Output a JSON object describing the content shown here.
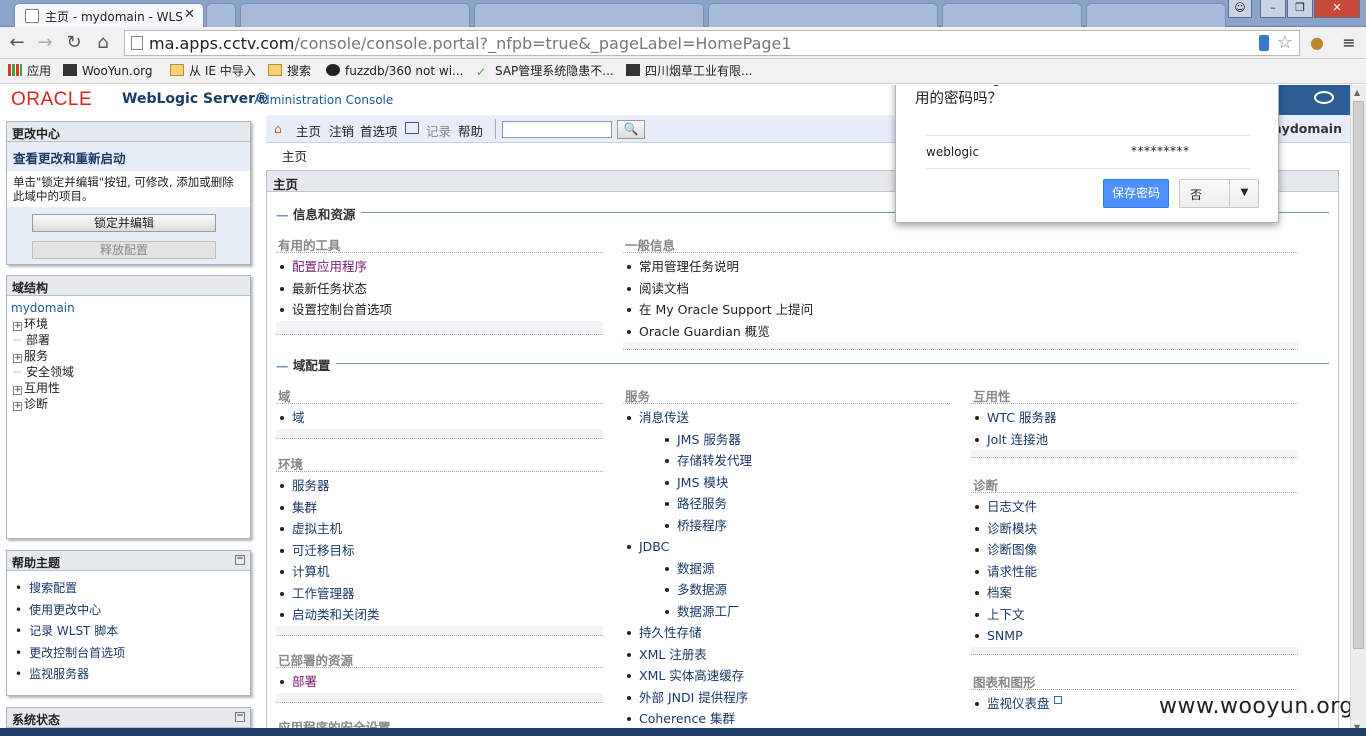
{
  "browser": {
    "active_tab_title": "主页 - mydomain - WLS",
    "inactive_tabs": [
      "",
      "",
      "",
      "",
      "",
      ""
    ],
    "url_host": "ma.apps.cctv.com",
    "url_path": "/console/console.portal?_nfpb=true&_pageLabel=HomePage1",
    "bookmarks": [
      "应用",
      "WooYun.org",
      "从 IE 中导入",
      "搜索",
      "fuzzdb/360 not wi...",
      "SAP管理系统隐患不...",
      "四川烟草工业有限..."
    ]
  },
  "header": {
    "logo": "ORACLE",
    "product": "WebLogic Server®",
    "subtitle": "Administration Console"
  },
  "change_center": {
    "title": "更改中心",
    "subtitle": "查看更改和重新启动",
    "description": "单击\"锁定并编辑\"按钮, 可修改, 添加或删除此域中的项目。",
    "lock_button": "锁定并编辑",
    "release_button": "释放配置"
  },
  "domain_structure": {
    "title": "域结构",
    "root": "mydomain",
    "nodes": [
      {
        "label": "环境",
        "expandable": true
      },
      {
        "label": "部署",
        "expandable": false
      },
      {
        "label": "服务",
        "expandable": true
      },
      {
        "label": "安全领域",
        "expandable": false
      },
      {
        "label": "互用性",
        "expandable": true
      },
      {
        "label": "诊断",
        "expandable": true
      }
    ]
  },
  "help_topics": {
    "title": "帮助主题",
    "items": [
      "搜索配置",
      "使用更改中心",
      "记录 WLST 脚本",
      "更改控制台首选项",
      "监视服务器"
    ]
  },
  "system_status": {
    "title": "系统状态"
  },
  "topnav": {
    "home": "主页",
    "logout": "注销",
    "preferences": "首选项",
    "record": "记录",
    "help": "帮助",
    "search_placeholder": "",
    "welcome_user": "mydomain"
  },
  "breadcrumb": "主页",
  "content_title": "主页",
  "sections": {
    "info": "信息和资源",
    "domain_config": "域配置"
  },
  "groups": {
    "useful_tools": {
      "title": "有用的工具",
      "items": [
        "配置应用程序",
        "最新任务状态",
        "设置控制台首选项"
      ]
    },
    "general_info": {
      "title": "一般信息",
      "items": [
        "常用管理任务说明",
        "阅读文档",
        "在 My Oracle Support 上提问",
        "Oracle Guardian 概览"
      ]
    },
    "domain": {
      "title": "域",
      "items": [
        "域"
      ]
    },
    "environment": {
      "title": "环境",
      "items": [
        "服务器",
        "集群",
        "虚拟主机",
        "可迁移目标",
        "计算机",
        "工作管理器",
        "启动类和关闭类"
      ]
    },
    "deployed": {
      "title": "已部署的资源",
      "items": [
        "部署"
      ]
    },
    "app_security": {
      "title": "应用程序的安全设置"
    },
    "services": {
      "title": "服务",
      "messaging": "消息传送",
      "messaging_items": [
        "JMS 服务器",
        "存储转发代理",
        "JMS 模块",
        "路径服务",
        "桥接程序"
      ],
      "jdbc": "JDBC",
      "jdbc_items": [
        "数据源",
        "多数据源",
        "数据源工厂"
      ],
      "others": [
        "持久性存储",
        "XML 注册表",
        "XML 实体高速缓存",
        "外部 JNDI 提供程序",
        "Coherence 集群"
      ]
    },
    "interop": {
      "title": "互用性",
      "items": [
        "WTC 服务器",
        "Jolt 连接池"
      ]
    },
    "diagnostics": {
      "title": "诊断",
      "items": [
        "日志文件",
        "诊断模块",
        "诊断图像",
        "请求性能",
        "档案",
        "上下文",
        "SNMP"
      ]
    },
    "charts": {
      "title": "图表和图形",
      "items": [
        "监视仪表盘"
      ]
    }
  },
  "password_bubble": {
    "question": "您希望 Google Chrome 浏览器保存您在此网站上使用的密码吗？",
    "username": "weblogic",
    "password_mask": "*********",
    "save_button": "保存密码",
    "no_button": "否"
  },
  "watermark": "www.wooyun.org"
}
